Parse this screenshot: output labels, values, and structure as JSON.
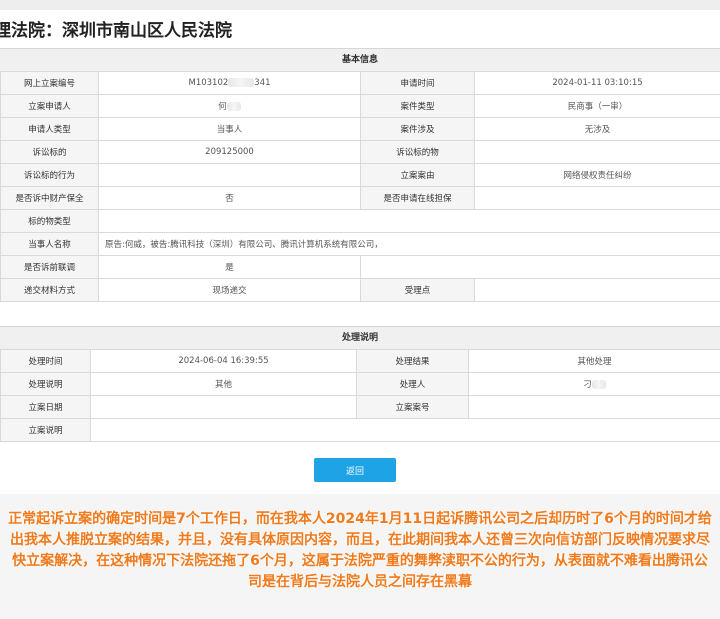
{
  "page": {
    "court_title": "理法院：深圳市南山区人民法院"
  },
  "basic_info": {
    "heading": "基本信息",
    "rows": [
      {
        "l1": "网上立案编号",
        "v1": "M103102",
        "v1_tail": "341",
        "l2": "申请时间",
        "v2": "2024-01-11 03:10:15"
      },
      {
        "l1": "立案申请人",
        "v1": "何",
        "l2": "案件类型",
        "v2": "民商事（一审）"
      },
      {
        "l1": "申请人类型",
        "v1": "当事人",
        "l2": "案件涉及",
        "v2": "无涉及"
      },
      {
        "l1": "诉讼标的",
        "v1": "209125000",
        "l2": "诉讼标的物",
        "v2": ""
      },
      {
        "l1": "诉讼标的行为",
        "v1": "",
        "l2": "立案案由",
        "v2": "网络侵权责任纠纷"
      },
      {
        "l1": "是否诉中财产保全",
        "v1": "否",
        "l2": "是否申请在线担保",
        "v2": ""
      }
    ],
    "subject_type_label": "标的物类型",
    "subject_type_value": "",
    "parties_label": "当事人名称",
    "parties_value": "原告:何威，被告:腾讯科技（深圳）有限公司、腾讯计算机系统有限公司，",
    "pre_litigation_label": "是否诉前联调",
    "pre_litigation_value": "是",
    "submit_method_label": "递交材料方式",
    "submit_method_value": "现场递交",
    "acceptance_point_label": "受理点",
    "acceptance_point_value": ""
  },
  "processing_info": {
    "heading": "处理说明",
    "time_label": "处理时间",
    "time_value": "2024-06-04 16:39:55",
    "result_label": "处理结果",
    "result_value": "其他处理",
    "note_label": "处理说明",
    "note_value": "其他",
    "handler_label": "处理人",
    "handler_value": "刁",
    "filing_date_label": "立案日期",
    "filing_date_value": "",
    "case_no_label": "立案案号",
    "case_no_value": "",
    "filing_note_label": "立案说明",
    "filing_note_value": ""
  },
  "actions": {
    "back_label": "返回"
  },
  "annotation": {
    "text": "正常起诉立案的确定时间是7个工作日，而在我本人2024年1月11日起诉腾讯公司之后却历时了6个月的时间才给出我本人推脱立案的结果，并且，没有具体原因内容，而且，在此期间我本人还曾三次向信访部门反映情况要求尽快立案解决，在这种情况下法院还拖了6个月，这属于法院严重的舞弊渎职不公的行为，从表面就不难看出腾讯公司是在背后与法院人员之间存在黑幕"
  },
  "colors": {
    "button": "#1ea3e6",
    "annotation_text": "#f07a1c",
    "label_bg": "#f5f5f5",
    "border": "#d9d9d9"
  }
}
